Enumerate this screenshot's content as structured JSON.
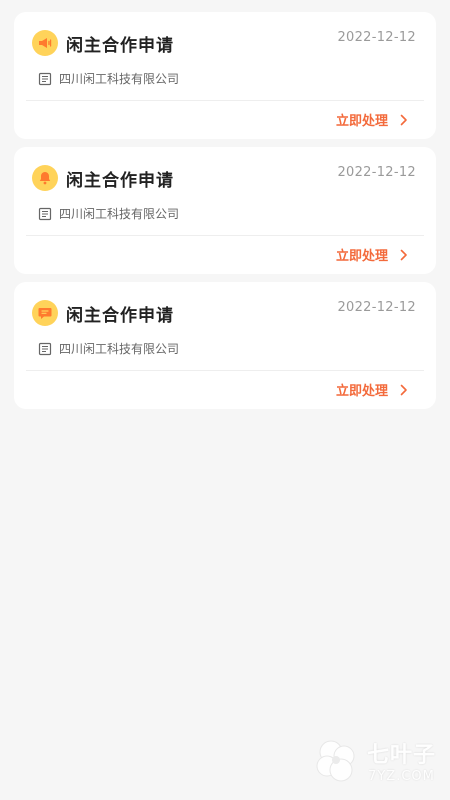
{
  "colors": {
    "background": "#f6f6f6",
    "card": "#ffffff",
    "accent": "#f36a3b",
    "icon_bg": "#ffd35a",
    "title": "#222222",
    "muted": "#9a9a9a"
  },
  "cards": [
    {
      "icon": "megaphone-icon",
      "title": "闲主合作申请",
      "date": "2022-12-12",
      "company": "四川闲工科技有限公司",
      "action_label": "立即处理"
    },
    {
      "icon": "bell-icon",
      "title": "闲主合作申请",
      "date": "2022-12-12",
      "company": "四川闲工科技有限公司",
      "action_label": "立即处理"
    },
    {
      "icon": "message-icon",
      "title": "闲主合作申请",
      "date": "2022-12-12",
      "company": "四川闲工科技有限公司",
      "action_label": "立即处理"
    }
  ],
  "watermark": {
    "name": "七叶子",
    "domain": "7YZ.COM"
  }
}
